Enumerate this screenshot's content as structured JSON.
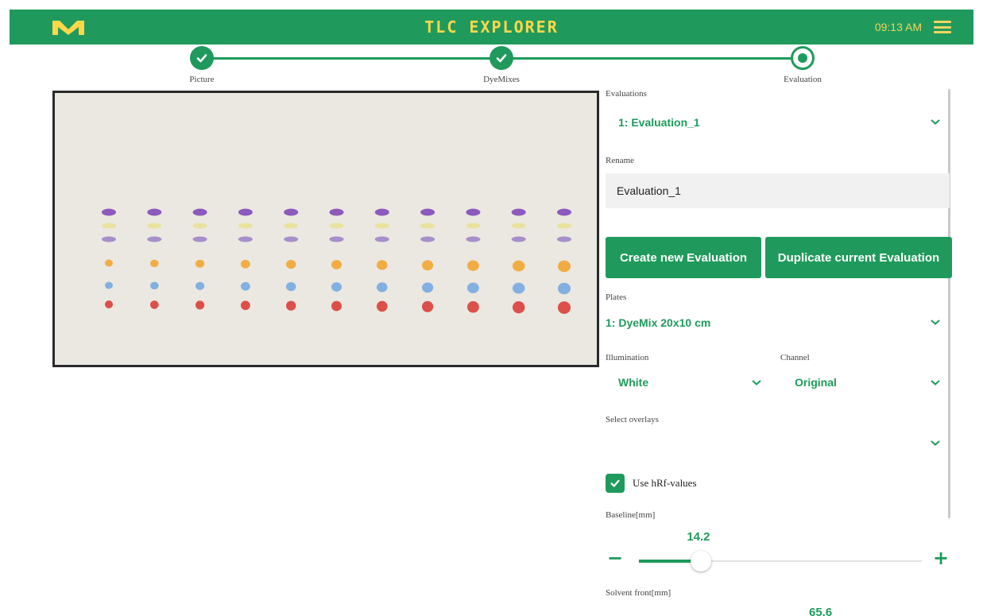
{
  "header": {
    "logo_icon": "merck-m-logo",
    "title": "TLC EXPLORER",
    "time": "09:13 AM",
    "menu_icon": "hamburger-menu-icon"
  },
  "colors": {
    "brand_green": "#1f9a5c",
    "header_text_yellow": "#ffd84a"
  },
  "stepper": {
    "steps": [
      {
        "label": "Picture",
        "state": "done"
      },
      {
        "label": "DyeMixes",
        "state": "done"
      },
      {
        "label": "Evaluation",
        "state": "active"
      }
    ]
  },
  "plate_image": {
    "lanes": 11,
    "spot_colors": [
      "#7b3fb5",
      "#e8dc6a",
      "#9a7fc6",
      "#f2a227",
      "#6fa6e0",
      "#d9342f"
    ]
  },
  "panel": {
    "evaluations_label": "Evaluations",
    "evaluations_value": "1: Evaluation_1",
    "rename_label": "Rename",
    "rename_value": "Evaluation_1",
    "create_button": "Create new Evaluation",
    "duplicate_button": "Duplicate current Evaluation",
    "plates_label": "Plates",
    "plates_value": "1: DyeMix 20x10 cm",
    "illumination_label": "Illumination",
    "illumination_value": "White",
    "channel_label": "Channel",
    "channel_value": "Original",
    "overlays_label": "Select overlays",
    "overlays_value": "",
    "hrf_label": "Use hRf-values",
    "hrf_checked": true,
    "baseline_label": "Baseline[mm]",
    "baseline_value": "14.2",
    "baseline_fraction": 0.22,
    "minus": "−",
    "plus": "+",
    "solvent_label": "Solvent front[mm]",
    "solvent_value": "65.6"
  }
}
